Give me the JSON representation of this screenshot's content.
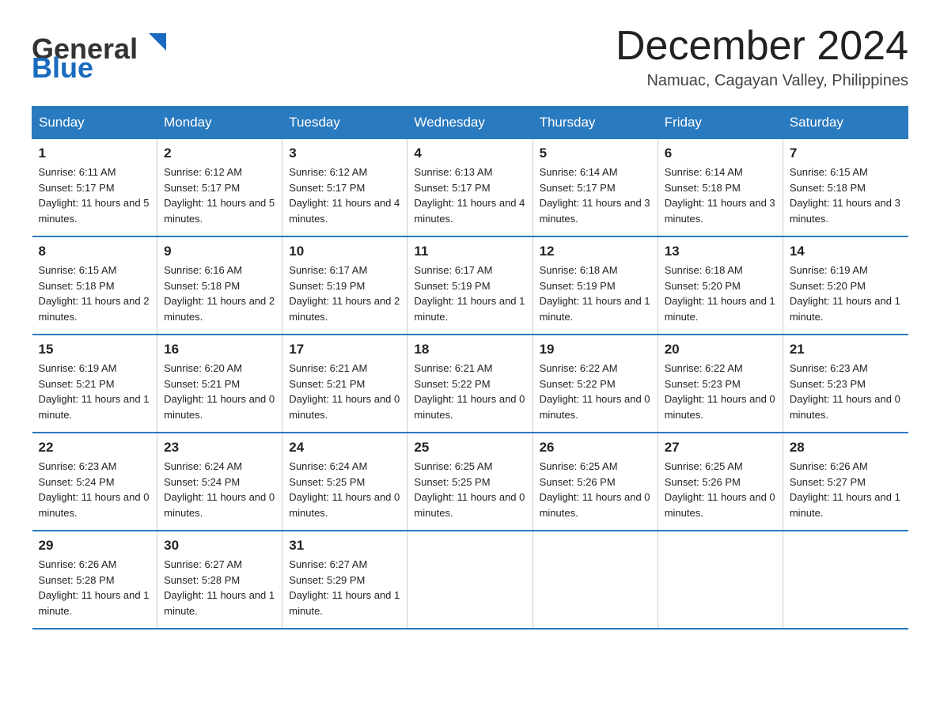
{
  "header": {
    "logo_text_general": "General",
    "logo_text_blue": "Blue",
    "month_title": "December 2024",
    "location": "Namuac, Cagayan Valley, Philippines"
  },
  "days_of_week": [
    "Sunday",
    "Monday",
    "Tuesday",
    "Wednesday",
    "Thursday",
    "Friday",
    "Saturday"
  ],
  "weeks": [
    [
      {
        "day": "1",
        "sunrise": "6:11 AM",
        "sunset": "5:17 PM",
        "daylight": "11 hours and 5 minutes."
      },
      {
        "day": "2",
        "sunrise": "6:12 AM",
        "sunset": "5:17 PM",
        "daylight": "11 hours and 5 minutes."
      },
      {
        "day": "3",
        "sunrise": "6:12 AM",
        "sunset": "5:17 PM",
        "daylight": "11 hours and 4 minutes."
      },
      {
        "day": "4",
        "sunrise": "6:13 AM",
        "sunset": "5:17 PM",
        "daylight": "11 hours and 4 minutes."
      },
      {
        "day": "5",
        "sunrise": "6:14 AM",
        "sunset": "5:17 PM",
        "daylight": "11 hours and 3 minutes."
      },
      {
        "day": "6",
        "sunrise": "6:14 AM",
        "sunset": "5:18 PM",
        "daylight": "11 hours and 3 minutes."
      },
      {
        "day": "7",
        "sunrise": "6:15 AM",
        "sunset": "5:18 PM",
        "daylight": "11 hours and 3 minutes."
      }
    ],
    [
      {
        "day": "8",
        "sunrise": "6:15 AM",
        "sunset": "5:18 PM",
        "daylight": "11 hours and 2 minutes."
      },
      {
        "day": "9",
        "sunrise": "6:16 AM",
        "sunset": "5:18 PM",
        "daylight": "11 hours and 2 minutes."
      },
      {
        "day": "10",
        "sunrise": "6:17 AM",
        "sunset": "5:19 PM",
        "daylight": "11 hours and 2 minutes."
      },
      {
        "day": "11",
        "sunrise": "6:17 AM",
        "sunset": "5:19 PM",
        "daylight": "11 hours and 1 minute."
      },
      {
        "day": "12",
        "sunrise": "6:18 AM",
        "sunset": "5:19 PM",
        "daylight": "11 hours and 1 minute."
      },
      {
        "day": "13",
        "sunrise": "6:18 AM",
        "sunset": "5:20 PM",
        "daylight": "11 hours and 1 minute."
      },
      {
        "day": "14",
        "sunrise": "6:19 AM",
        "sunset": "5:20 PM",
        "daylight": "11 hours and 1 minute."
      }
    ],
    [
      {
        "day": "15",
        "sunrise": "6:19 AM",
        "sunset": "5:21 PM",
        "daylight": "11 hours and 1 minute."
      },
      {
        "day": "16",
        "sunrise": "6:20 AM",
        "sunset": "5:21 PM",
        "daylight": "11 hours and 0 minutes."
      },
      {
        "day": "17",
        "sunrise": "6:21 AM",
        "sunset": "5:21 PM",
        "daylight": "11 hours and 0 minutes."
      },
      {
        "day": "18",
        "sunrise": "6:21 AM",
        "sunset": "5:22 PM",
        "daylight": "11 hours and 0 minutes."
      },
      {
        "day": "19",
        "sunrise": "6:22 AM",
        "sunset": "5:22 PM",
        "daylight": "11 hours and 0 minutes."
      },
      {
        "day": "20",
        "sunrise": "6:22 AM",
        "sunset": "5:23 PM",
        "daylight": "11 hours and 0 minutes."
      },
      {
        "day": "21",
        "sunrise": "6:23 AM",
        "sunset": "5:23 PM",
        "daylight": "11 hours and 0 minutes."
      }
    ],
    [
      {
        "day": "22",
        "sunrise": "6:23 AM",
        "sunset": "5:24 PM",
        "daylight": "11 hours and 0 minutes."
      },
      {
        "day": "23",
        "sunrise": "6:24 AM",
        "sunset": "5:24 PM",
        "daylight": "11 hours and 0 minutes."
      },
      {
        "day": "24",
        "sunrise": "6:24 AM",
        "sunset": "5:25 PM",
        "daylight": "11 hours and 0 minutes."
      },
      {
        "day": "25",
        "sunrise": "6:25 AM",
        "sunset": "5:25 PM",
        "daylight": "11 hours and 0 minutes."
      },
      {
        "day": "26",
        "sunrise": "6:25 AM",
        "sunset": "5:26 PM",
        "daylight": "11 hours and 0 minutes."
      },
      {
        "day": "27",
        "sunrise": "6:25 AM",
        "sunset": "5:26 PM",
        "daylight": "11 hours and 0 minutes."
      },
      {
        "day": "28",
        "sunrise": "6:26 AM",
        "sunset": "5:27 PM",
        "daylight": "11 hours and 1 minute."
      }
    ],
    [
      {
        "day": "29",
        "sunrise": "6:26 AM",
        "sunset": "5:28 PM",
        "daylight": "11 hours and 1 minute."
      },
      {
        "day": "30",
        "sunrise": "6:27 AM",
        "sunset": "5:28 PM",
        "daylight": "11 hours and 1 minute."
      },
      {
        "day": "31",
        "sunrise": "6:27 AM",
        "sunset": "5:29 PM",
        "daylight": "11 hours and 1 minute."
      },
      null,
      null,
      null,
      null
    ]
  ],
  "labels": {
    "sunrise": "Sunrise:",
    "sunset": "Sunset:",
    "daylight": "Daylight:"
  }
}
